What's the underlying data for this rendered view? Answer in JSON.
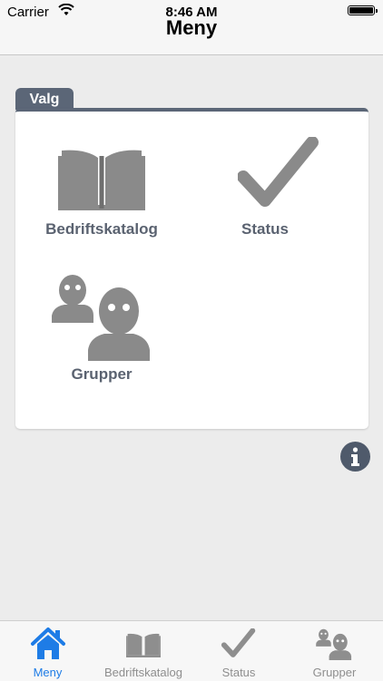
{
  "status_bar": {
    "carrier": "Carrier",
    "time": "8:46 AM"
  },
  "nav": {
    "title": "Meny"
  },
  "section": {
    "tab_label": "Valg"
  },
  "tiles": [
    {
      "label": "Bedriftskatalog",
      "icon": "book-icon"
    },
    {
      "label": "Status",
      "icon": "checkmark-icon"
    },
    {
      "label": "Grupper",
      "icon": "people-icon"
    }
  ],
  "tab_bar": {
    "items": [
      {
        "label": "Meny",
        "icon": "home-icon",
        "active": true
      },
      {
        "label": "Bedriftskatalog",
        "icon": "book-icon",
        "active": false
      },
      {
        "label": "Status",
        "icon": "checkmark-icon",
        "active": false
      },
      {
        "label": "Grupper",
        "icon": "people-icon",
        "active": false
      }
    ]
  },
  "colors": {
    "accent": "#1e7ce6",
    "header_tab": "#5b6677",
    "icon_gray": "#8a8a8a",
    "label_gray": "#5a6270"
  }
}
